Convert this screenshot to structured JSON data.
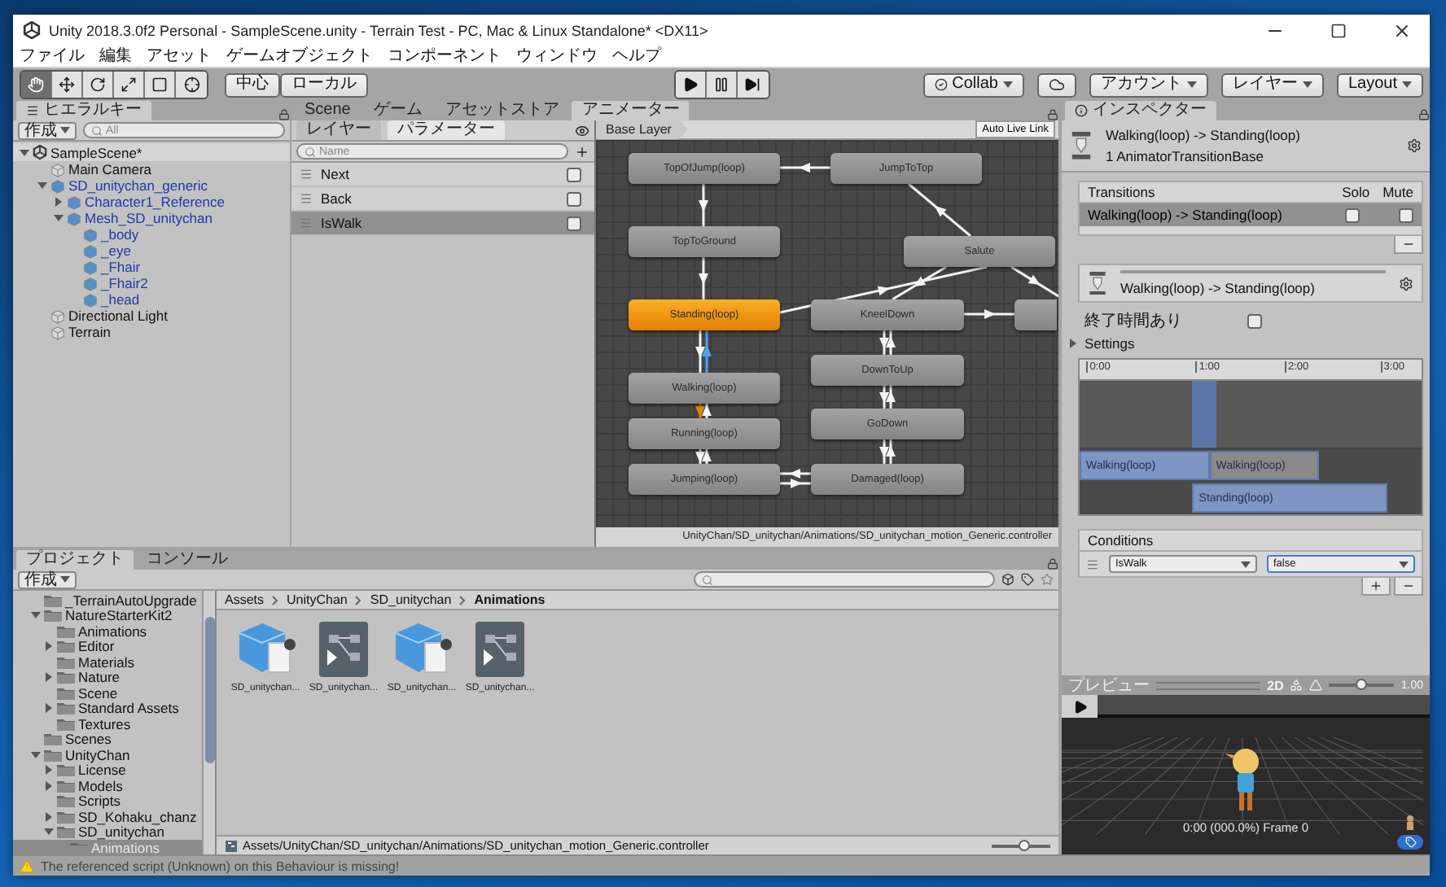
{
  "window": {
    "title": "Unity 2018.3.0f2 Personal - SampleScene.unity - Terrain Test - PC, Mac & Linux Standalone* <DX11>"
  },
  "menu": [
    "ファイル",
    "編集",
    "アセット",
    "ゲームオブジェクト",
    "コンポーネント",
    "ウィンドウ",
    "ヘルプ"
  ],
  "toolbar": {
    "tools": [
      {
        "selected": true
      },
      {
        "selected": false
      },
      {
        "selected": false
      },
      {
        "selected": false
      },
      {
        "selected": false
      },
      {
        "selected": false
      }
    ],
    "pivot_buttons": [
      "中心",
      "ローカル"
    ],
    "collab": "Collab",
    "account": "アカウント",
    "layers": "レイヤー",
    "layout": "Layout"
  },
  "hierarchy": {
    "tab": "ヒエラルキー",
    "create": "作成",
    "search_placeholder": "All",
    "scene": {
      "label": "SampleScene*",
      "expanded": true,
      "children": [
        {
          "label": "Main Camera",
          "prefab": false
        },
        {
          "label": "SD_unitychan_generic",
          "prefab": true,
          "expanded": true,
          "children": [
            {
              "label": "Character1_Reference",
              "prefab": true,
              "expanded": false
            },
            {
              "label": "Mesh_SD_unitychan",
              "prefab": true,
              "expanded": true,
              "children": [
                {
                  "label": "_body",
                  "prefab": true
                },
                {
                  "label": "_eye",
                  "prefab": true
                },
                {
                  "label": "_Fhair",
                  "prefab": true
                },
                {
                  "label": "_Fhair2",
                  "prefab": true
                },
                {
                  "label": "_head",
                  "prefab": true
                }
              ]
            }
          ]
        },
        {
          "label": "Directional Light",
          "prefab": false
        },
        {
          "label": "Terrain",
          "prefab": false
        }
      ]
    }
  },
  "animator": {
    "tabs": [
      {
        "label": "Scene",
        "selected": false
      },
      {
        "label": "ゲーム",
        "selected": false
      },
      {
        "label": "アセットストア",
        "selected": false
      },
      {
        "label": "アニメーター",
        "selected": true
      }
    ],
    "panel_tabs": [
      {
        "label": "レイヤー",
        "selected": false
      },
      {
        "label": "パラメーター",
        "selected": true
      }
    ],
    "search_placeholder": "Name",
    "parameters": [
      {
        "name": "Next",
        "value": false,
        "selected": false
      },
      {
        "name": "Back",
        "value": false,
        "selected": false
      },
      {
        "name": "IsWalk",
        "value": false,
        "selected": true
      }
    ],
    "layer": "Base Layer",
    "live_link": "Auto Live Link",
    "nodes": [
      {
        "label": "TopOfJump(loop)",
        "default": false
      },
      {
        "label": "JumpToTop",
        "default": false
      },
      {
        "label": "TopToGround",
        "default": false
      },
      {
        "label": "Salute",
        "default": false
      },
      {
        "label": "Standing(loop)",
        "default": true
      },
      {
        "label": "KneelDown",
        "default": false
      },
      {
        "label": "Walking(loop)",
        "default": false
      },
      {
        "label": "DownToUp",
        "default": false
      },
      {
        "label": "Running(loop)",
        "default": false
      },
      {
        "label": "GoDown",
        "default": false
      },
      {
        "label": "Jumping(loop)",
        "default": false
      },
      {
        "label": "Damaged(loop)",
        "default": false
      }
    ],
    "path": "UnityChan/SD_unitychan/Animations/SD_unitychan_motion_Generic.controller"
  },
  "inspector": {
    "tab": "インスペクター",
    "title": "Walking(loop) -> Standing(loop)",
    "subtitle": "1 AnimatorTransitionBase",
    "transitions_header": "Transitions",
    "solo": "Solo",
    "mute": "Mute",
    "transitions": [
      {
        "label": "Walking(loop) -> Standing(loop)",
        "solo": false,
        "mute": false,
        "selected": true
      }
    ],
    "transition_name": "Walking(loop) -> Standing(loop)",
    "has_exit_time": {
      "label": "終了時間あり",
      "checked": false
    },
    "settings": {
      "label": "Settings",
      "expanded": false
    },
    "timeline": {
      "ticks": [
        "0:00",
        "1:00",
        "2:00",
        "3:00"
      ],
      "clips": [
        {
          "label": "Walking(loop)",
          "kind": "source"
        },
        {
          "label": "Walking(loop)",
          "kind": "next"
        },
        {
          "label": "Standing(loop)",
          "kind": "destination"
        }
      ]
    },
    "conditions": {
      "header": "Conditions",
      "rows": [
        {
          "parameter": "IsWalk",
          "value": "false"
        }
      ]
    }
  },
  "preview": {
    "title": "プレビュー",
    "mode": "2D",
    "speed": "1.00",
    "level": 0.5,
    "status": "0:00 (000.0%) Frame 0"
  },
  "project": {
    "tabs": [
      {
        "label": "プロジェクト",
        "selected": true
      },
      {
        "label": "コンソール",
        "selected": false
      }
    ],
    "create": "作成",
    "folders": [
      {
        "label": "_TerrainAutoUpgrade",
        "selected": false
      },
      {
        "label": "NatureStarterKit2",
        "expanded": true,
        "selected": false,
        "children": [
          {
            "label": "Animations",
            "selected": false
          },
          {
            "label": "Editor",
            "expanded": false,
            "selected": false
          },
          {
            "label": "Materials",
            "selected": false
          },
          {
            "label": "Nature",
            "expanded": false,
            "selected": false
          },
          {
            "label": "Scene",
            "selected": false
          },
          {
            "label": "Standard Assets",
            "expanded": false,
            "selected": false
          },
          {
            "label": "Textures",
            "selected": false
          }
        ]
      },
      {
        "label": "Scenes",
        "selected": false
      },
      {
        "label": "UnityChan",
        "expanded": true,
        "selected": false,
        "children": [
          {
            "label": "License",
            "expanded": false,
            "selected": false
          },
          {
            "label": "Models",
            "expanded": false,
            "selected": false
          },
          {
            "label": "Scripts",
            "selected": false
          },
          {
            "label": "SD_Kohaku_chanz",
            "expanded": false,
            "selected": false
          },
          {
            "label": "SD_unitychan",
            "expanded": true,
            "selected": false,
            "children": [
              {
                "label": "Animations",
                "selected": true
              }
            ]
          }
        ]
      }
    ],
    "breadcrumb": [
      "Assets",
      "UnityChan",
      "SD_unitychan",
      "Animations"
    ],
    "assets": [
      {
        "label": "SD_unitychan...",
        "kind": "model"
      },
      {
        "label": "SD_unitychan...",
        "kind": "controller"
      },
      {
        "label": "SD_unitychan...",
        "kind": "model"
      },
      {
        "label": "SD_unitychan...",
        "kind": "controller"
      }
    ],
    "path": "Assets/UnityChan/SD_unitychan/Animations/SD_unitychan_motion_Generic.controller",
    "zoom": {
      "level": 0.55
    }
  },
  "status_bar": {
    "message": "The referenced script (Unknown) on this Behaviour is missing!"
  }
}
